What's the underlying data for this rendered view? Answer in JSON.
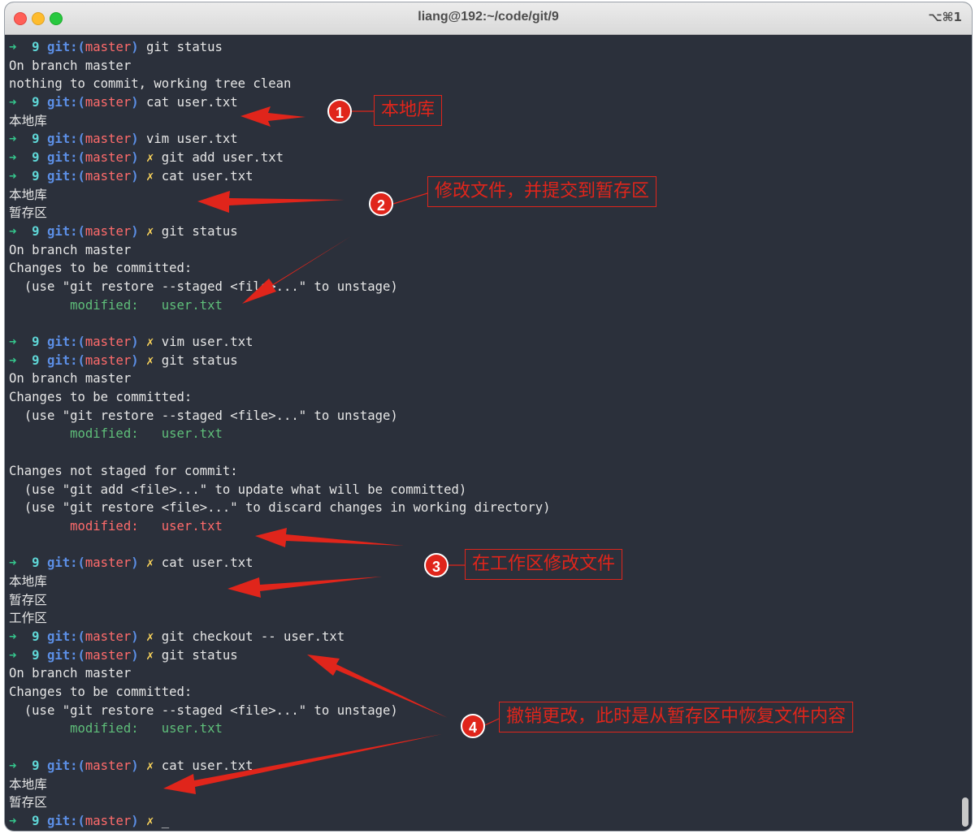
{
  "window": {
    "title": "liang@192:~/code/git/9",
    "shortcut": "⌥⌘1"
  },
  "terminal": {
    "lines": [
      [
        {
          "t": "➜ ",
          "c": "arrow"
        },
        {
          "t": " 9 ",
          "c": "dir"
        },
        {
          "t": "git:(",
          "c": "git"
        },
        {
          "t": "master",
          "c": "branch"
        },
        {
          "t": ")",
          "c": "git"
        },
        {
          "t": " git status",
          "c": ""
        }
      ],
      [
        {
          "t": "On branch master",
          "c": ""
        }
      ],
      [
        {
          "t": "nothing to commit, working tree clean",
          "c": ""
        }
      ],
      [
        {
          "t": "➜ ",
          "c": "arrow"
        },
        {
          "t": " 9 ",
          "c": "dir"
        },
        {
          "t": "git:(",
          "c": "git"
        },
        {
          "t": "master",
          "c": "branch"
        },
        {
          "t": ")",
          "c": "git"
        },
        {
          "t": " cat user.txt",
          "c": ""
        }
      ],
      [
        {
          "t": "本地库",
          "c": ""
        }
      ],
      [
        {
          "t": "➜ ",
          "c": "arrow"
        },
        {
          "t": " 9 ",
          "c": "dir"
        },
        {
          "t": "git:(",
          "c": "git"
        },
        {
          "t": "master",
          "c": "branch"
        },
        {
          "t": ")",
          "c": "git"
        },
        {
          "t": " vim user.txt",
          "c": ""
        }
      ],
      [
        {
          "t": "➜ ",
          "c": "arrow"
        },
        {
          "t": " 9 ",
          "c": "dir"
        },
        {
          "t": "git:(",
          "c": "git"
        },
        {
          "t": "master",
          "c": "branch"
        },
        {
          "t": ")",
          "c": "git"
        },
        {
          "t": " ✗",
          "c": "x"
        },
        {
          "t": " git add user.txt",
          "c": ""
        }
      ],
      [
        {
          "t": "➜ ",
          "c": "arrow"
        },
        {
          "t": " 9 ",
          "c": "dir"
        },
        {
          "t": "git:(",
          "c": "git"
        },
        {
          "t": "master",
          "c": "branch"
        },
        {
          "t": ")",
          "c": "git"
        },
        {
          "t": " ✗",
          "c": "x"
        },
        {
          "t": " cat user.txt",
          "c": ""
        }
      ],
      [
        {
          "t": "本地库",
          "c": ""
        }
      ],
      [
        {
          "t": "暂存区",
          "c": ""
        }
      ],
      [
        {
          "t": "➜ ",
          "c": "arrow"
        },
        {
          "t": " 9 ",
          "c": "dir"
        },
        {
          "t": "git:(",
          "c": "git"
        },
        {
          "t": "master",
          "c": "branch"
        },
        {
          "t": ")",
          "c": "git"
        },
        {
          "t": " ✗",
          "c": "x"
        },
        {
          "t": " git status",
          "c": ""
        }
      ],
      [
        {
          "t": "On branch master",
          "c": ""
        }
      ],
      [
        {
          "t": "Changes to be committed:",
          "c": ""
        }
      ],
      [
        {
          "t": "  (use \"git restore --staged <file>...\" to unstage)",
          "c": ""
        }
      ],
      [
        {
          "t": "        modified:   user.txt",
          "c": "mg"
        }
      ],
      [
        {
          "t": "",
          "c": ""
        }
      ],
      [
        {
          "t": "➜ ",
          "c": "arrow"
        },
        {
          "t": " 9 ",
          "c": "dir"
        },
        {
          "t": "git:(",
          "c": "git"
        },
        {
          "t": "master",
          "c": "branch"
        },
        {
          "t": ")",
          "c": "git"
        },
        {
          "t": " ✗",
          "c": "x"
        },
        {
          "t": " vim user.txt",
          "c": ""
        }
      ],
      [
        {
          "t": "➜ ",
          "c": "arrow"
        },
        {
          "t": " 9 ",
          "c": "dir"
        },
        {
          "t": "git:(",
          "c": "git"
        },
        {
          "t": "master",
          "c": "branch"
        },
        {
          "t": ")",
          "c": "git"
        },
        {
          "t": " ✗",
          "c": "x"
        },
        {
          "t": " git status",
          "c": ""
        }
      ],
      [
        {
          "t": "On branch master",
          "c": ""
        }
      ],
      [
        {
          "t": "Changes to be committed:",
          "c": ""
        }
      ],
      [
        {
          "t": "  (use \"git restore --staged <file>...\" to unstage)",
          "c": ""
        }
      ],
      [
        {
          "t": "        modified:   user.txt",
          "c": "mg"
        }
      ],
      [
        {
          "t": "",
          "c": ""
        }
      ],
      [
        {
          "t": "Changes not staged for commit:",
          "c": ""
        }
      ],
      [
        {
          "t": "  (use \"git add <file>...\" to update what will be committed)",
          "c": ""
        }
      ],
      [
        {
          "t": "  (use \"git restore <file>...\" to discard changes in working directory)",
          "c": ""
        }
      ],
      [
        {
          "t": "        modified:   user.txt",
          "c": "mr"
        }
      ],
      [
        {
          "t": "",
          "c": ""
        }
      ],
      [
        {
          "t": "➜ ",
          "c": "arrow"
        },
        {
          "t": " 9 ",
          "c": "dir"
        },
        {
          "t": "git:(",
          "c": "git"
        },
        {
          "t": "master",
          "c": "branch"
        },
        {
          "t": ")",
          "c": "git"
        },
        {
          "t": " ✗",
          "c": "x"
        },
        {
          "t": " cat user.txt",
          "c": ""
        }
      ],
      [
        {
          "t": "本地库",
          "c": ""
        }
      ],
      [
        {
          "t": "暂存区",
          "c": ""
        }
      ],
      [
        {
          "t": "工作区",
          "c": ""
        }
      ],
      [
        {
          "t": "➜ ",
          "c": "arrow"
        },
        {
          "t": " 9 ",
          "c": "dir"
        },
        {
          "t": "git:(",
          "c": "git"
        },
        {
          "t": "master",
          "c": "branch"
        },
        {
          "t": ")",
          "c": "git"
        },
        {
          "t": " ✗",
          "c": "x"
        },
        {
          "t": " git checkout -- user.txt",
          "c": ""
        }
      ],
      [
        {
          "t": "➜ ",
          "c": "arrow"
        },
        {
          "t": " 9 ",
          "c": "dir"
        },
        {
          "t": "git:(",
          "c": "git"
        },
        {
          "t": "master",
          "c": "branch"
        },
        {
          "t": ")",
          "c": "git"
        },
        {
          "t": " ✗",
          "c": "x"
        },
        {
          "t": " git status",
          "c": ""
        }
      ],
      [
        {
          "t": "On branch master",
          "c": ""
        }
      ],
      [
        {
          "t": "Changes to be committed:",
          "c": ""
        }
      ],
      [
        {
          "t": "  (use \"git restore --staged <file>...\" to unstage)",
          "c": ""
        }
      ],
      [
        {
          "t": "        modified:   user.txt",
          "c": "mg"
        }
      ],
      [
        {
          "t": "",
          "c": ""
        }
      ],
      [
        {
          "t": "➜ ",
          "c": "arrow"
        },
        {
          "t": " 9 ",
          "c": "dir"
        },
        {
          "t": "git:(",
          "c": "git"
        },
        {
          "t": "master",
          "c": "branch"
        },
        {
          "t": ")",
          "c": "git"
        },
        {
          "t": " ✗",
          "c": "x"
        },
        {
          "t": " cat user.txt",
          "c": ""
        }
      ],
      [
        {
          "t": "本地库",
          "c": ""
        }
      ],
      [
        {
          "t": "暂存区",
          "c": ""
        }
      ],
      [
        {
          "t": "➜ ",
          "c": "arrow"
        },
        {
          "t": " 9 ",
          "c": "dir"
        },
        {
          "t": "git:(",
          "c": "git"
        },
        {
          "t": "master",
          "c": "branch"
        },
        {
          "t": ")",
          "c": "git"
        },
        {
          "t": " ✗",
          "c": "x"
        },
        {
          "t": " _",
          "c": ""
        }
      ]
    ]
  },
  "annotations": [
    {
      "number": "1",
      "text": "本地库"
    },
    {
      "number": "2",
      "text": "修改文件，并提交到暂存区"
    },
    {
      "number": "3",
      "text": "在工作区修改文件"
    },
    {
      "number": "4",
      "text": "撤销更改，此时是从暂存区中恢复文件内容"
    }
  ],
  "colors": {
    "background": "#2b303b",
    "annotation_red": "#e0251b",
    "prompt_green": "#35c78d",
    "git_blue": "#5c8fe6",
    "branch_red": "#ff6b6b",
    "dirty_yellow": "#f7d15a"
  }
}
